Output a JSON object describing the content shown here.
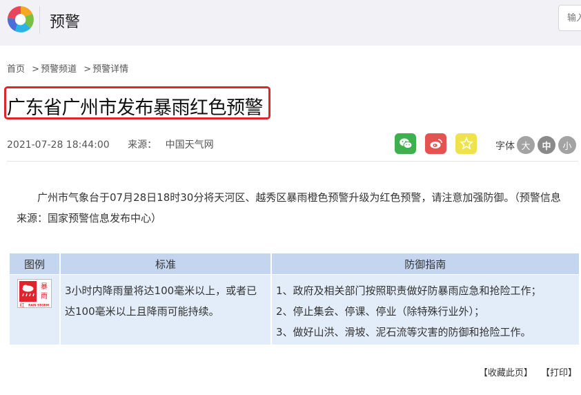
{
  "header": {
    "site_title": "预警",
    "search_placeholder": "输入"
  },
  "breadcrumb": {
    "items": [
      "首页",
      "预警频道",
      "预警详情"
    ],
    "separator": ">"
  },
  "article": {
    "title": "广东省广州市发布暴雨红色预警",
    "datetime": "2021-07-28 18:44:00",
    "source_label": "来源：",
    "source_value": "中国天气网",
    "body": "广州市气象台于07月28日18时30分将天河区、越秀区暴雨橙色预警升级为红色预警，请注意加强防御。（预警信息来源：国家预警信息发布中心）"
  },
  "font_size": {
    "label": "字体",
    "options": [
      "大",
      "中",
      "小"
    ],
    "selected": "中"
  },
  "share": {
    "icons": [
      "wechat-icon",
      "weibo-icon",
      "star-icon"
    ],
    "colors": [
      "#3fb04f",
      "#e55350",
      "#efe24b"
    ]
  },
  "table": {
    "headers": [
      "图例",
      "标准",
      "防御指南"
    ],
    "icon": {
      "name": "rainstorm-red-warning-icon",
      "main_text": "暴雨",
      "level_text": "红",
      "english_text": "RAIN STORM",
      "color": "#e0242b"
    },
    "standard": "3小时内降雨量将达100毫米以上，或者已达100毫米以上且降雨可能持续。",
    "guidance": [
      "1、政府及相关部门按照职责做好防暴雨应急和抢险工作；",
      "2、停止集会、停课、停业（除特殊行业外）；",
      "3、做好山洪、滑坡、泥石流等灾害的防御和抢险工作。"
    ]
  },
  "footer": {
    "bookmark": "【收藏此页】",
    "print": "【打印】"
  },
  "colors": {
    "header_bg": "#f2f2f6",
    "title_border": "#e0242b",
    "table_header_bg": "#c3d5ef",
    "table_cell_bg": "#e3ecf9"
  }
}
